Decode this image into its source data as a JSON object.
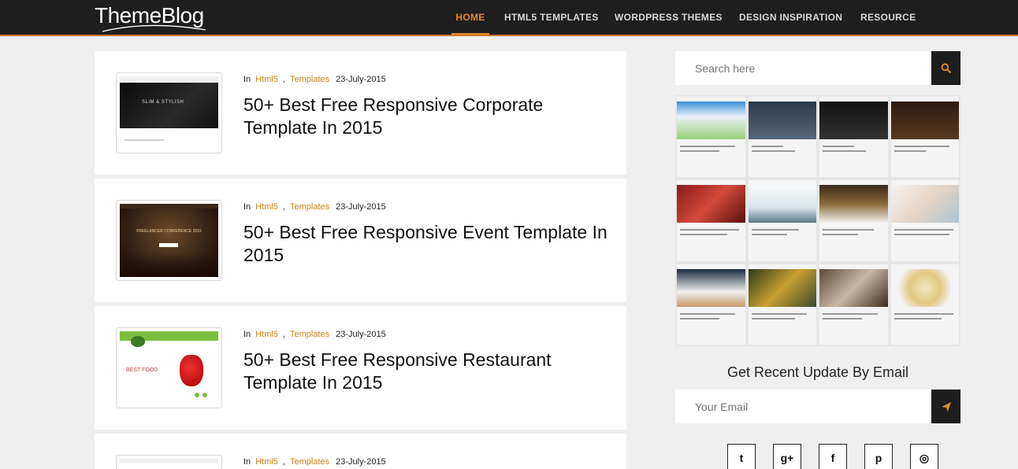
{
  "header": {
    "logo": "ThemeBlog",
    "nav": [
      {
        "label": "HOME",
        "active": true
      },
      {
        "label": "HTML5 TEMPLATES",
        "active": false
      },
      {
        "label": "WORDPRESS THEMES",
        "active": false
      },
      {
        "label": "DESIGN INSPIRATION",
        "active": false
      },
      {
        "label": "RESOURCE",
        "active": false
      }
    ]
  },
  "posts": [
    {
      "in_label": "In",
      "cat1": "Html5",
      "sep": ",",
      "cat2": "Templates",
      "date": "23-July-2015",
      "title": "50+ Best Free Responsive Corporate Template In 2015",
      "thumb_text": "SLIM & STYLISH"
    },
    {
      "in_label": "In",
      "cat1": "Html5",
      "sep": ",",
      "cat2": "Templates",
      "date": "23-July-2015",
      "title": "50+ Best Free Responsive Event Template In 2015",
      "thumb_text": "FREELANCER CONFERENCE 2015"
    },
    {
      "in_label": "In",
      "cat1": "Html5",
      "sep": ",",
      "cat2": "Templates",
      "date": "23-July-2015",
      "title": "50+ Best Free Responsive Restaurant Template In 2015",
      "thumb_text": "BEST FOOD"
    },
    {
      "in_label": "In",
      "cat1": "Html5",
      "sep": ",",
      "cat2": "Templates",
      "date": "23-July-2015",
      "title": "",
      "thumb_text": ""
    }
  ],
  "sidebar": {
    "search_placeholder": "Search here",
    "update_title": "Get Recent Update By Email",
    "email_placeholder": "Your Email",
    "socials": [
      {
        "icon": "twitter-icon",
        "glyph": "t"
      },
      {
        "icon": "google-plus-icon",
        "glyph": "g+"
      },
      {
        "icon": "facebook-icon",
        "glyph": "f"
      },
      {
        "icon": "pinterest-icon",
        "glyph": "p"
      },
      {
        "icon": "instagram-icon",
        "glyph": "◎"
      }
    ]
  },
  "colors": {
    "accent": "#e0892e",
    "dark": "#1e1e1e",
    "category": "#c98219"
  }
}
